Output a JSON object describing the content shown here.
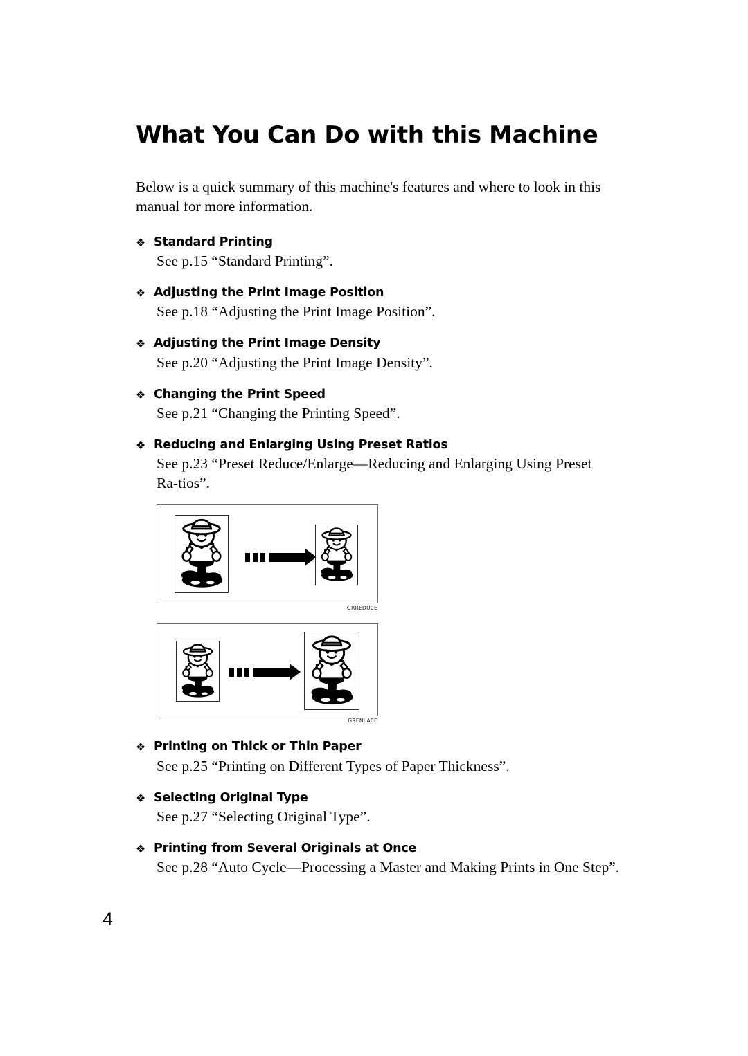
{
  "document": {
    "page_title": "What You Can Do with this Machine",
    "intro": "Below is a quick summary of this machine's features and where to look in this manual for more information.",
    "page_number": "4",
    "bullet_glyph": "❖"
  },
  "features": [
    {
      "title": "Standard Printing",
      "body": "See p.15 “Standard Printing”."
    },
    {
      "title": "Adjusting the Print Image Position",
      "body": "See p.18 “Adjusting the Print Image Position”."
    },
    {
      "title": "Adjusting the Print Image Density",
      "body": "See p.20 “Adjusting the Print Image Density”."
    },
    {
      "title": "Changing the Print Speed",
      "body": "See p.21 “Changing the Printing Speed”."
    },
    {
      "title": "Reducing and Enlarging Using Preset Ratios",
      "body": "See p.23 “Preset Reduce/Enlarge—Reducing and Enlarging Using Preset Ra-tios”."
    },
    {
      "title": "Printing on Thick or Thin Paper",
      "body": "See p.25 “Printing on Different Types of Paper Thickness”."
    },
    {
      "title": "Selecting Original Type",
      "body": "See p.27 “Selecting Original Type”."
    },
    {
      "title": "Printing from Several Originals at Once",
      "body": "See p.28 “Auto Cycle—Processing a Master and Making Prints in One Step”."
    }
  ],
  "figures": [
    {
      "name": "reduction-illustration",
      "caption": "GRREDU0E",
      "description": "Large original reduced to a smaller print",
      "left_size": "large",
      "right_size": "small"
    },
    {
      "name": "enlargement-illustration",
      "caption": "GRENLA0E",
      "description": "Small original enlarged to a larger print",
      "left_size": "small",
      "right_size": "large"
    }
  ],
  "colors": {
    "text": "#000000",
    "figure_frame": "#6b6b6b",
    "paper_frame": "#2c2c2c",
    "background": "#ffffff"
  }
}
